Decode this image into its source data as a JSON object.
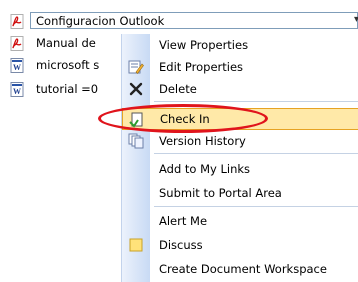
{
  "documents": [
    {
      "name": "Configuracion Outlook",
      "icon": "pdf-icon",
      "selected": true
    },
    {
      "name": "Manual de",
      "icon": "pdf-icon"
    },
    {
      "name": "microsoft s",
      "icon": "word-icon"
    },
    {
      "name": "tutorial =0",
      "icon": "word-icon"
    }
  ],
  "menu": {
    "items": [
      {
        "label": "View Properties",
        "icon": ""
      },
      {
        "label": "Edit Properties",
        "icon": "edit-properties-icon"
      },
      {
        "label": "Delete",
        "icon": "delete-icon"
      },
      {
        "label": "Check In",
        "icon": "check-in-icon",
        "highlighted": true
      },
      {
        "label": "Version History",
        "icon": "version-history-icon"
      },
      {
        "label": "Add to My Links",
        "icon": ""
      },
      {
        "label": "Submit to Portal Area",
        "icon": ""
      },
      {
        "label": "Alert Me",
        "icon": ""
      },
      {
        "label": "Discuss",
        "icon": "discuss-icon"
      },
      {
        "label": "Create Document Workspace",
        "icon": ""
      }
    ]
  },
  "colors": {
    "highlight_fill": "#ffe9a8",
    "highlight_border": "#e6a323",
    "annotation": "#e0141c"
  }
}
